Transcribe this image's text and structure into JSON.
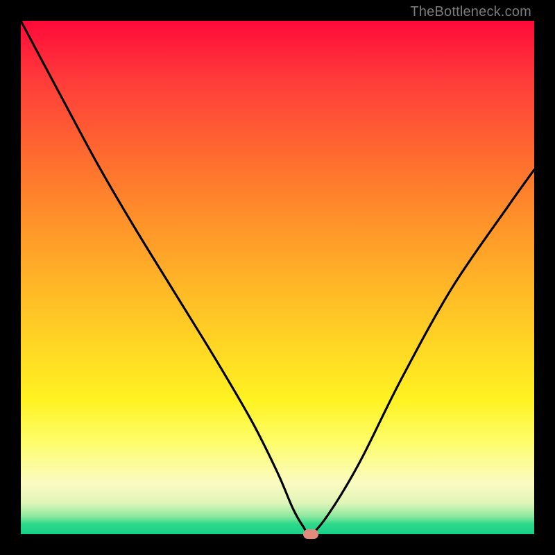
{
  "watermark": "TheBottleneck.com",
  "chart_data": {
    "type": "line",
    "title": "",
    "xlabel": "",
    "ylabel": "",
    "xlim": [
      0,
      100
    ],
    "ylim": [
      0,
      100
    ],
    "grid": false,
    "legend": false,
    "series": [
      {
        "name": "bottleneck-curve",
        "x": [
          0,
          8,
          15,
          22,
          30,
          38,
          45,
          50,
          53,
          55,
          56.5,
          60,
          66,
          74,
          84,
          95,
          100
        ],
        "values": [
          100,
          85,
          72,
          60,
          47,
          34,
          22,
          12,
          5,
          1.5,
          0,
          4,
          14,
          30,
          48,
          64,
          71
        ]
      }
    ],
    "marker": {
      "x": 56.5,
      "y": 0,
      "color": "#e18a7e"
    },
    "background_gradient": {
      "top": "#ff0a3a",
      "mid": "#ffd324",
      "bottom": "#16d18a"
    }
  }
}
